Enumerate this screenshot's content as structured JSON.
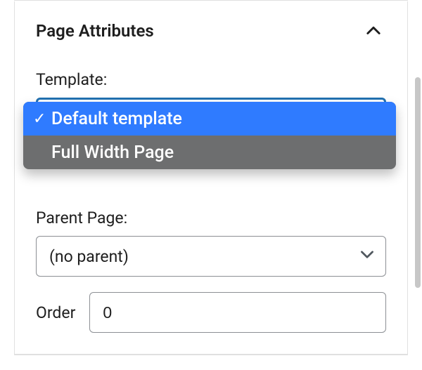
{
  "panel": {
    "title": "Page Attributes"
  },
  "template": {
    "label": "Template:",
    "options": [
      {
        "label": "Default template",
        "selected": true
      },
      {
        "label": "Full Width Page",
        "selected": false
      }
    ]
  },
  "parent": {
    "label": "Parent Page:",
    "value": "(no parent)"
  },
  "order": {
    "label": "Order",
    "value": "0"
  },
  "icons": {
    "check": "✓"
  }
}
